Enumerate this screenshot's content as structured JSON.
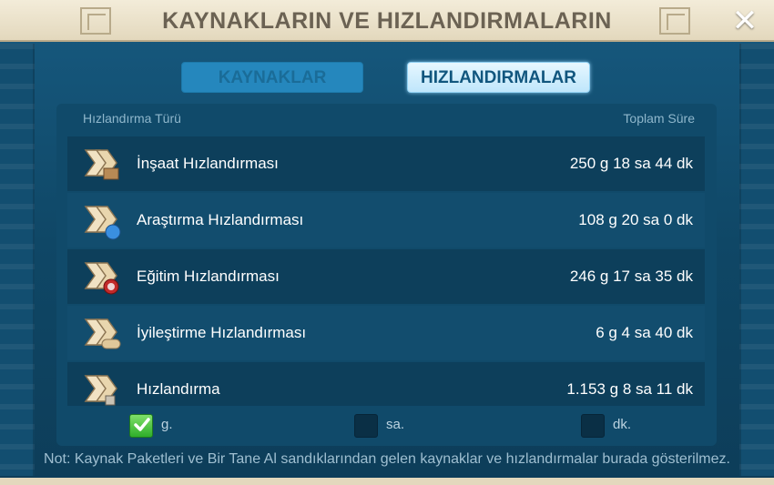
{
  "window": {
    "title": "KAYNAKLARIN VE HIZLANDIRMALARIN",
    "close_symbol": "✕"
  },
  "tabs": [
    {
      "label": "KAYNAKLAR",
      "active": false
    },
    {
      "label": "HIZLANDIRMALAR",
      "active": true
    }
  ],
  "table": {
    "col_type": "Hızlandırma Türü",
    "col_total": "Toplam Süre",
    "rows": [
      {
        "label": "İnşaat Hızlandırması",
        "value": "250 g 18 sa 44 dk",
        "icon": "construction-speedup-icon"
      },
      {
        "label": "Araştırma Hızlandırması",
        "value": "108 g 20 sa 0 dk",
        "icon": "research-speedup-icon"
      },
      {
        "label": "Eğitim Hızlandırması",
        "value": "246 g 17 sa 35 dk",
        "icon": "training-speedup-icon"
      },
      {
        "label": "İyileştirme Hızlandırması",
        "value": "6 g 4 sa 40 dk",
        "icon": "healing-speedup-icon"
      },
      {
        "label": "Hızlandırma",
        "value": "1.153 g 8 sa 11 dk",
        "icon": "universal-speedup-icon"
      }
    ]
  },
  "units": [
    {
      "label": "g.",
      "checked": true
    },
    {
      "label": "sa.",
      "checked": false
    },
    {
      "label": "dk.",
      "checked": false
    }
  ],
  "note": "Not: Kaynak Paketleri ve Bir Tane Al sandıklarından gelen kaynaklar ve hızlandırmalar burada gösterilmez.",
  "colors": {
    "accent_green": "#2fae2a",
    "panel": "#104a6a",
    "title_text": "#6b6253"
  }
}
